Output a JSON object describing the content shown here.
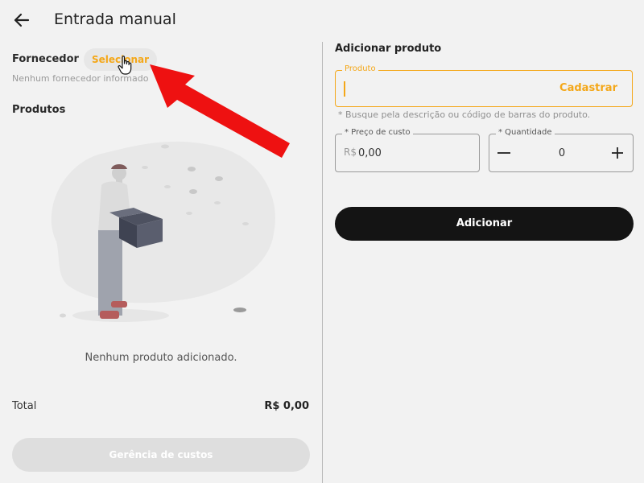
{
  "header": {
    "title": "Entrada manual",
    "back_icon": "arrow-left-icon"
  },
  "supplier": {
    "label": "Fornecedor",
    "select_label": "Selecionar",
    "empty_text": "Nenhum fornecedor informado"
  },
  "products": {
    "title": "Produtos",
    "empty_text": "Nenhum produto adicionado."
  },
  "totals": {
    "label": "Total",
    "value": "R$ 0,00"
  },
  "cost_button": {
    "label": "Gerência de custos"
  },
  "add_product": {
    "title": "Adicionar produto",
    "product_field": {
      "legend": "Produto",
      "value": "",
      "register_label": "Cadastrar",
      "hint": "* Busque pela descrição ou código de barras do produto."
    },
    "price_field": {
      "legend": "* Preço de custo",
      "prefix": "R$",
      "value": "0,00"
    },
    "quantity_field": {
      "legend": "* Quantidade",
      "value": "0"
    },
    "add_label": "Adicionar"
  },
  "colors": {
    "accent": "#f4a718",
    "primary_button": "#141414",
    "disabled_button": "#dedede",
    "annotation_arrow": "#ee1111"
  }
}
